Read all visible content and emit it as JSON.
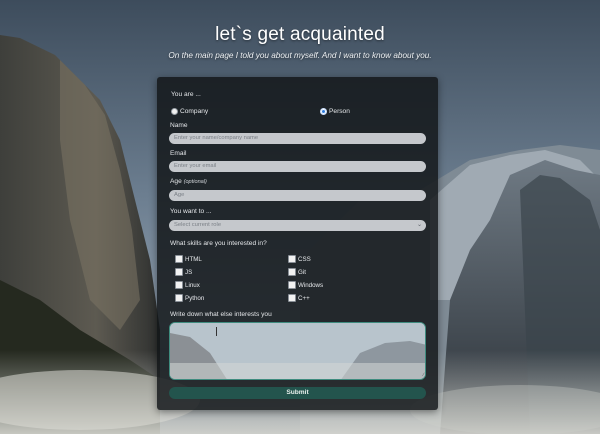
{
  "page": {
    "title": "let`s get acquainted",
    "subtitle": "On the main page I told you about myself. And I want to know about you."
  },
  "form": {
    "you_are_label": "You are ...",
    "user_types": [
      {
        "label": "Company",
        "checked": false
      },
      {
        "label": "Person",
        "checked": true
      }
    ],
    "name_label": "Name",
    "name_placeholder": "Enter your name/company name",
    "email_label": "Email",
    "email_placeholder": "Enter your email",
    "age_label": "Age",
    "age_optional": "(optional)",
    "age_placeholder": "Age",
    "want_label": "You want to ...",
    "role_selected": "Select current role",
    "skills_label": "What skills are you interested in?",
    "skills_left": [
      "HTML",
      "JS",
      "Linux",
      "Python"
    ],
    "skills_right": [
      "CSS",
      "Git",
      "Windows",
      "C++"
    ],
    "interests_label": "Write down what else interests you",
    "interests_value": "",
    "submit_label": "Submit"
  },
  "colors": {
    "accent_teal": "#3f8c7f",
    "submit_bg": "#23544d",
    "radio_checked": "#2f7ddf"
  },
  "icons": {
    "select_arrow": "chevron-down-icon",
    "resize_handle": "resize-grip-icon"
  }
}
